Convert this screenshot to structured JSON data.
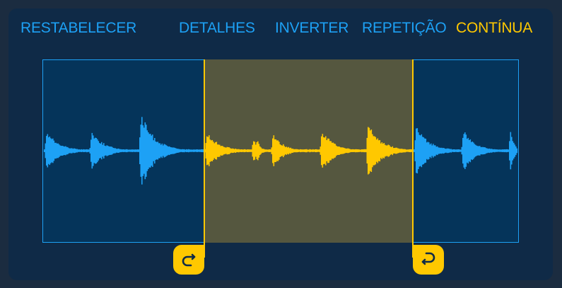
{
  "toolbar": {
    "reset": "RESTABELECER",
    "details": "DETALHES",
    "reverse": "INVERTER",
    "repeat": "REPETIÇÃO",
    "continuous": "CONTÍNUA"
  },
  "colors": {
    "accent": "#1da1f5",
    "selected": "#ffc800",
    "loop_fill": "#55573f",
    "background": "#0f2a47"
  },
  "icons": {
    "loop_start": "loop-start-arrow-icon",
    "loop_end": "loop-end-arrow-icon"
  }
}
